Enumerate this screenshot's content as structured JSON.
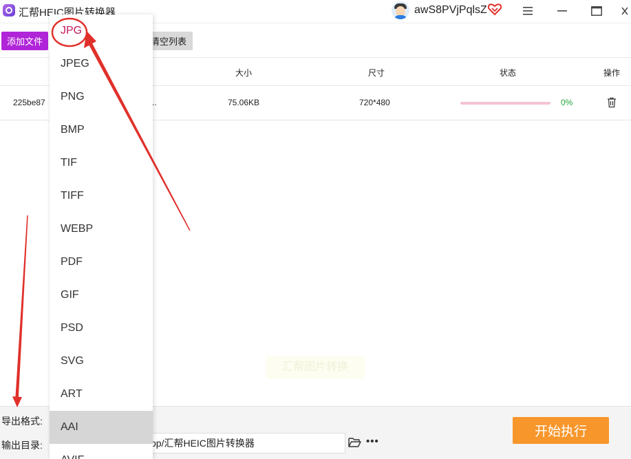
{
  "app": {
    "title": "汇帮HEIC图片转换器",
    "username": "awS8PVjPqlsZ"
  },
  "window_controls": {
    "menu_icon": "hamburger-icon",
    "minimize_icon": "minimize-icon",
    "maximize_icon": "maximize-icon",
    "close_icon": "close-icon"
  },
  "toolbar": {
    "add_file_label": "添加文件",
    "clear_list_label": "清空列表"
  },
  "table": {
    "headers": {
      "size": "大小",
      "dimensions": "尺寸",
      "status": "状态",
      "action": "操作"
    },
    "rows": [
      {
        "name": "225be87",
        "name_tail": "..",
        "size": "75.06KB",
        "dimensions": "720*480",
        "progress": 0,
        "progress_text": "0%"
      }
    ]
  },
  "format_menu": {
    "selected": "JPG",
    "hovered": "AAI",
    "items": [
      "JPG",
      "JPEG",
      "PNG",
      "BMP",
      "TIF",
      "TIFF",
      "WEBP",
      "PDF",
      "GIF",
      "PSD",
      "SVG",
      "ART",
      "AAI",
      "AVIF"
    ]
  },
  "bottom": {
    "format_label": "导出格式:",
    "dir_label": "输出目录:",
    "dir_value": "op/汇帮HEIC图片转换器",
    "start_label": "开始执行"
  },
  "watermark": {
    "text": "汇帮图片转换"
  },
  "colors": {
    "accent_purple": "#b025d8",
    "start_orange": "#f7962b",
    "selected_text": "#c2185b",
    "progress_green": "#22a63b",
    "annotation_red": "#e0302b"
  }
}
